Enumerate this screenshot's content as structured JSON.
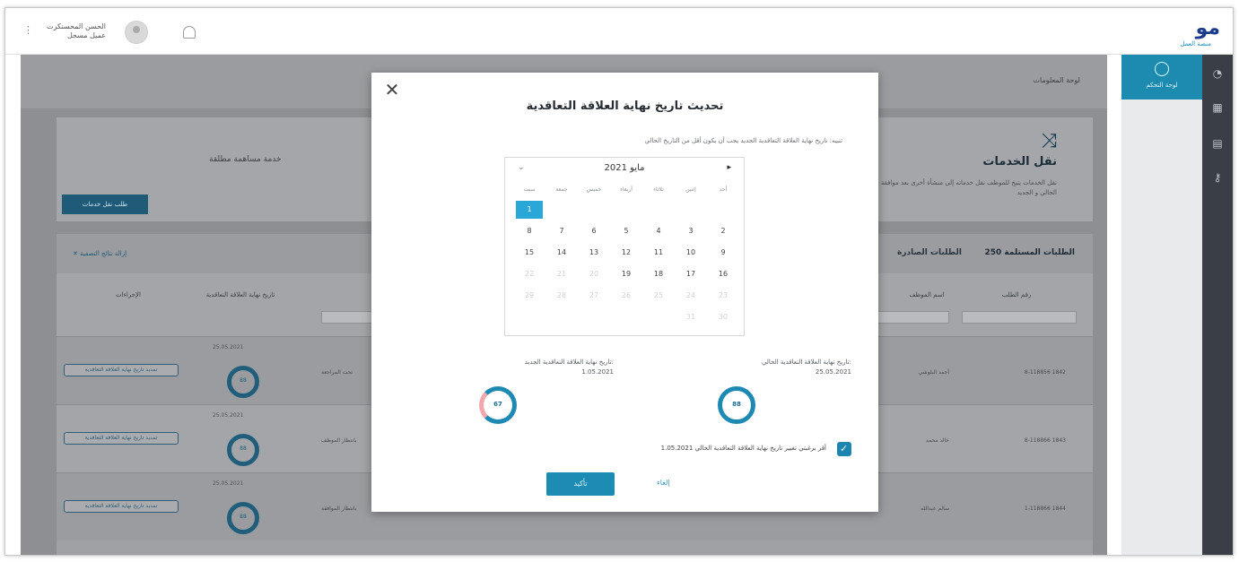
{
  "topbar": {
    "logo_mark": "مو",
    "logo_sub": "منصة العمل",
    "user_name": "الحسن المحسنكرت",
    "user_subtitle": "عميل مسجل"
  },
  "nav": {
    "active_label": "لوحة التحكم"
  },
  "page": {
    "breadcrumb": "لوحة المعلومات",
    "title": "نقل الخدمات",
    "description": "نقل الخدمات يتيح للموظف نقل خدماته إلى منشأة أخرى بعد موافقة صاحب العمل الحالي و الجديد",
    "ghost_text": "خدمة مساهمة مطلقة",
    "request_button": "طلب نقل خدمات"
  },
  "tabs": {
    "received": "الطلبات المستلمة 250",
    "sent": "الطلبات الصادرة",
    "clear_filters": "إزالة نتائج التصفية"
  },
  "table": {
    "headers": [
      "رقم الطلب",
      "اسم الموظف",
      "تاريخ نهاية العلاقة التعاقدية",
      "الإجراءات"
    ],
    "rows": [
      {
        "id": "8-118856 1842",
        "name": "أحمد البلوشي",
        "date": "25.05.2021",
        "ring": "88",
        "action": "تمديد تاريخ نهاية العلاقة التعاقدية",
        "status": "تحت المراجعة"
      },
      {
        "id": "8-118866 1843",
        "name": "خالد محمد",
        "date": "25.05.2021",
        "ring": "88",
        "action": "تمديد تاريخ نهاية العلاقة التعاقدية",
        "status": "بانتظار الموظف"
      },
      {
        "id": "1-118866 1844",
        "name": "سالم عبدالله",
        "date": "25.05.2021",
        "ring": "88",
        "action": "تمديد تاريخ نهاية العلاقة التعاقدية",
        "status": "بانتظار الموافقة"
      }
    ]
  },
  "modal": {
    "title": "تحديث تاريخ نهاية العلاقة التعاقدية",
    "note": "تنبيه: تاريخ نهاية العلاقة التعاقدية الجديد يجب أن يكون أقل من التاريخ الحالي",
    "calendar": {
      "month_label": "مايو 2021",
      "days_of_week": [
        "أحد",
        "إثنين",
        "ثلاثاء",
        "أربعاء",
        "خميس",
        "جمعة",
        "سبت"
      ],
      "weeks": [
        [
          "",
          "",
          "",
          "",
          "",
          "",
          "1"
        ],
        [
          "2",
          "3",
          "4",
          "5",
          "6",
          "7",
          "8"
        ],
        [
          "9",
          "10",
          "11",
          "12",
          "13",
          "14",
          "15"
        ],
        [
          "16",
          "17",
          "18",
          "19",
          "20",
          "21",
          "22"
        ],
        [
          "23",
          "24",
          "25",
          "26",
          "27",
          "28",
          "29"
        ],
        [
          "30",
          "31",
          "",
          "",
          "",
          "",
          ""
        ]
      ],
      "selected_day": "1"
    },
    "current_label": "تاريخ نهاية العلاقة التعاقدية الحالي:",
    "current_value": "25.05.2021",
    "current_ring": "88",
    "new_label": "تاريخ نهاية العلاقة التعاقدية الجديد:",
    "new_value": "1.05.2021",
    "new_ring": "67",
    "agree_text": "أقر برغبتي تغيير تاريخ نهاية العلاقة التعاقدية الحالي 1.05.2021",
    "confirm": "تأكيد",
    "cancel": "إلغاء"
  }
}
